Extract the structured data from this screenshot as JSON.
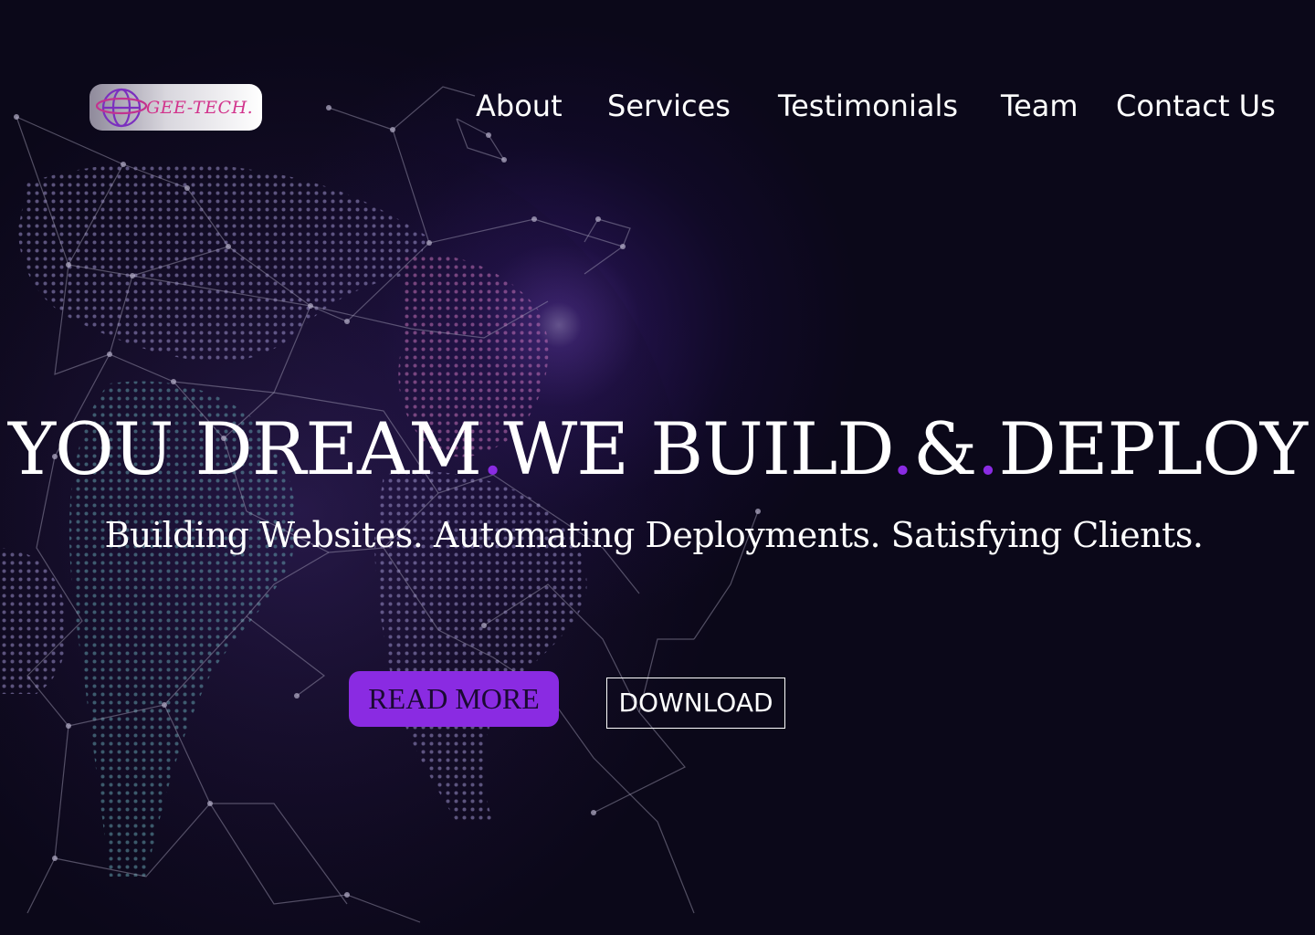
{
  "header": {
    "logo": {
      "text": "GEE-TECH.",
      "icon": "globe-icon"
    },
    "nav": [
      {
        "label": "About"
      },
      {
        "label": "Services"
      },
      {
        "label": "Testimonials"
      },
      {
        "label": "Team"
      },
      {
        "label": "Contact Us"
      }
    ]
  },
  "hero": {
    "headline": {
      "part1": "YOU DREAM",
      "part2": "WE BUILD",
      "part3": "&",
      "part4": "DEPLOY",
      "separator": "."
    },
    "subheading": "Building Websites. Automating Deployments. Satisfying Clients.",
    "primary_button": "READ MORE",
    "secondary_button": "DOWNLOAD"
  },
  "colors": {
    "background": "#0b0819",
    "accent": "#8a2be2",
    "logo_text": "#d2338c",
    "text": "#ffffff"
  },
  "background_image": "world-map-network-icon"
}
